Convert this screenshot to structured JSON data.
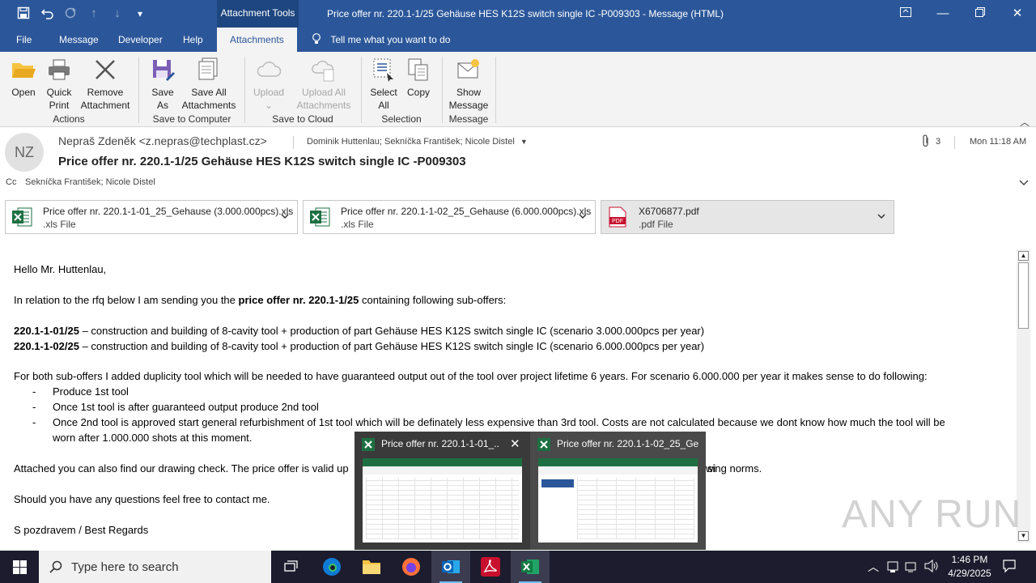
{
  "window": {
    "attachment_tools_label": "Attachment Tools",
    "title": "Price offer nr. 220.1-1/25 Gehäuse HES K12S switch single IC -P009303  -  Message (HTML)"
  },
  "tabs": [
    "File",
    "Message",
    "Developer",
    "Help",
    "Attachments"
  ],
  "tell_me": "Tell me what you want to do",
  "ribbon": {
    "open": "Open",
    "quick_print_1": "Quick",
    "quick_print_2": "Print",
    "remove_1": "Remove",
    "remove_2": "Attachment",
    "group_actions": "Actions",
    "save_as_1": "Save",
    "save_as_2": "As",
    "save_all_1": "Save All",
    "save_all_2": "Attachments",
    "group_save_computer": "Save to Computer",
    "upload": "Upload",
    "upload_all_1": "Upload All",
    "upload_all_2": "Attachments",
    "group_save_cloud": "Save to Cloud",
    "select_all_1": "Select",
    "select_all_2": "All",
    "copy": "Copy",
    "group_selection": "Selection",
    "show_message_1": "Show",
    "show_message_2": "Message",
    "group_message": "Message"
  },
  "header": {
    "avatar_initials": "NZ",
    "sender": "Nepraš Zdeněk <z.nepras@techplast.cz>",
    "to": "Dominik Huttenlau; Sekníčka František; Nicole Distel",
    "attachment_count": "3",
    "time": "Mon 11:18 AM",
    "subject": "Price offer nr. 220.1-1/25 Gehäuse HES K12S switch single IC -P009303",
    "cc_label": "Cc",
    "cc": "Sekníčka František; Nicole Distel"
  },
  "attachments": [
    {
      "name": "Price offer nr. 220.1-1-01_25_Gehause (3.000.000pcs).xls",
      "type": ".xls File"
    },
    {
      "name": "Price offer nr. 220.1-1-02_25_Gehause (6.000.000pcs).xls",
      "type": ".xls File"
    },
    {
      "name": "X6706877.pdf",
      "type": ".pdf File"
    }
  ],
  "body": {
    "greeting": "Hello Mr. Huttenlau,",
    "p1_a": "In relation to the rfq below I am sending you the ",
    "p1_b": "price offer nr. 220.1-1/25",
    "p1_c": " containing following sub-offers:",
    "o1_a": "220.1-1-01/25",
    "o1_b": " – construction and building of 8-cavity tool + production of part Gehäuse HES K12S switch single IC (scenario 3.000.000pcs per year)",
    "o2_a": "220.1-1-02/25",
    "o2_b": " – construction and building of 8-cavity tool + production of part Gehäuse HES K12S switch single IC (scenario 6.000.000pcs per year)",
    "p2": "For both sub-offers I added duplicity tool which will be needed to have guaranteed output out of the tool over project lifetime 6 years. For scenario 6.000.000 per year it makes sense to do following:",
    "dash": "-",
    "li1": "Produce 1st tool",
    "li2": "Once 1st tool is after guaranteed output produce 2nd tool",
    "li3a": "Once 2nd tool is approved start general refurbishment of 1st tool which will be definately less expensive than 3rd tool. Costs are not calculated because we dont know how much the tool will be",
    "li3b": "worn after 1.000.000 shots at this moment.",
    "p3a": "Attached you can also find our drawing check. The price offer is valid up",
    "p3b": "wi",
    "p3c": "sing norms.",
    "p4": "Should you have any questions feel free to contact me.",
    "p5": "S pozdravem / Best Regards"
  },
  "thumbnails": [
    {
      "title": "Price offer nr. 220.1-1-01_..."
    },
    {
      "title": "Price offer nr. 220.1-1-02_25_Ge..."
    }
  ],
  "taskbar": {
    "search_placeholder": "Type here to search",
    "time": "1:46 PM",
    "date": "4/29/2025"
  },
  "watermark": "ANY RUN",
  "colors": {
    "accent": "#2b579a",
    "excel": "#1d6f42",
    "pdf": "#c8102e"
  }
}
